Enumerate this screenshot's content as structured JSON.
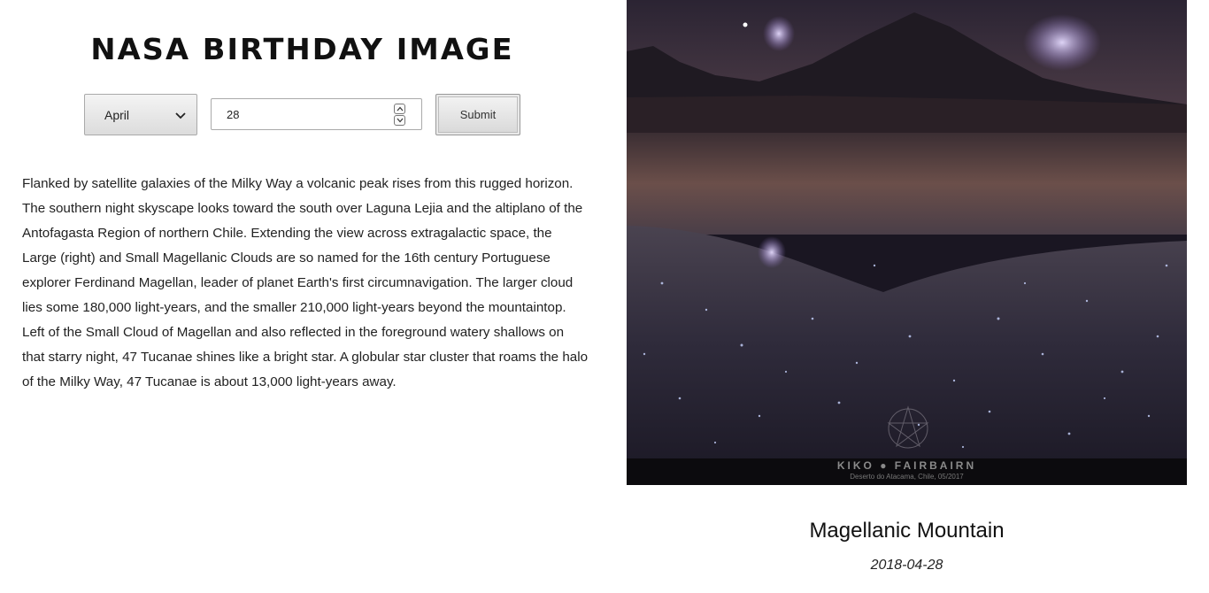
{
  "header": {
    "title": "NASA BIRTHDAY IMAGE"
  },
  "form": {
    "month_value": "April",
    "day_value": "28",
    "submit_label": "Submit"
  },
  "apod": {
    "explanation": "Flanked by satellite galaxies of the Milky Way a volcanic peak rises from this rugged horizon. The southern night skyscape looks toward the south over Laguna Lejia and the altiplano of the Antofagasta Region of northern Chile. Extending the view across extragalactic space, the Large (right) and Small Magellanic Clouds are so named for the 16th century Portuguese explorer Ferdinand Magellan, leader of planet Earth's first circumnavigation. The larger cloud lies some 180,000 light-years, and the smaller 210,000 light-years beyond the mountaintop. Left of the Small Cloud of Magellan and also reflected in the foreground watery shallows on that starry night, 47 Tucanae shines like a bright star. A globular star cluster that roams the halo of the Milky Way, 47 Tucanae is about 13,000 light-years away.",
    "title": "Magellanic Mountain",
    "date": "2018-04-28",
    "image_credit": "KIKO ● FAIRBAIRN",
    "image_location": "Deserto do Atacama, Chile, 05/2017"
  },
  "icons": {
    "select_chevron": "chevron-down-icon",
    "spin_up": "chevron-up-icon",
    "spin_down": "chevron-down-icon"
  },
  "colors": {
    "sky_top": "#2a2330",
    "sky_horizon": "#6b4a4a",
    "mountain": "#1f1a22",
    "water": "#2e2a3a"
  }
}
